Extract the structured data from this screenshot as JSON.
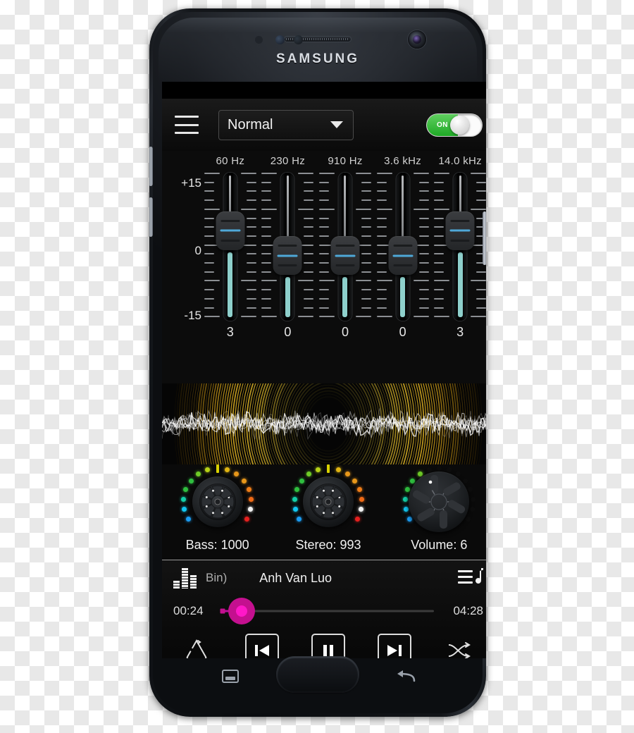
{
  "device": {
    "brand": "SAMSUNG",
    "nav": {
      "recents": "recents-button",
      "home": "home-button",
      "back": "back-button"
    },
    "hardware": {
      "power": "power-button",
      "volume_up": "volume-up-button",
      "volume_down": "volume-down-button"
    }
  },
  "header": {
    "menu_icon": "hamburger-menu-icon",
    "preset": {
      "selected": "Normal",
      "caret_icon": "chevron-down-icon"
    },
    "power_toggle": {
      "state_label": "ON",
      "enabled": true,
      "on_color": "#21ab27"
    }
  },
  "equalizer": {
    "scale": {
      "top": "+15",
      "mid": "0",
      "bottom": "-15"
    },
    "bands": [
      {
        "frequency": "60 Hz",
        "value": "3",
        "gain": 3,
        "thumb_top_pct": 26
      },
      {
        "frequency": "230 Hz",
        "value": "0",
        "gain": 0,
        "thumb_top_pct": 43
      },
      {
        "frequency": "910 Hz",
        "value": "0",
        "gain": 0,
        "thumb_top_pct": 43
      },
      {
        "frequency": "3.6 kHz",
        "value": "0",
        "gain": 0,
        "thumb_top_pct": 43
      },
      {
        "frequency": "14.0 kHz",
        "value": "3",
        "gain": 3,
        "thumb_top_pct": 26
      }
    ],
    "fill_color": "#8ed0cc",
    "thumb_line_color": "#4fa8d8"
  },
  "visualizer": {
    "name": "audio-waveform-visualizer",
    "wave_color": "#ffffff",
    "arc_color": "#c8950d"
  },
  "knobs": [
    {
      "name": "bass-knob",
      "label": "Bass: 1000",
      "param": "Bass",
      "value": "1000",
      "style": "ridged",
      "leds_lit": 13
    },
    {
      "name": "stereo-knob",
      "label": "Stereo: 993",
      "param": "Stereo",
      "value": "993",
      "style": "ridged",
      "leds_lit": 13
    },
    {
      "name": "volume-knob",
      "label": "Volume: 6",
      "param": "Volume",
      "value": "6",
      "style": "spoked",
      "leds_lit": 6
    }
  ],
  "led_colors": [
    "#1b9bf0",
    "#12c6f0",
    "#13cfa8",
    "#2fbf3f",
    "#6ecb27",
    "#b7d117",
    "#d9d200",
    "#dfb413",
    "#e8971a",
    "#ee7d18",
    "#ef6a16",
    "#e5201f"
  ],
  "player": {
    "eq_icon": "equalizer-bars-icon",
    "playlist_icon": "playlist-music-note-icon",
    "artist": "Bin)",
    "title": "Anh Van Luo",
    "time_elapsed": "00:24",
    "time_total": "04:28",
    "progress_pct": 9,
    "accent_color": "#c4108f",
    "controls": {
      "repeat": "repeat-button",
      "previous": "previous-track-button",
      "playpause": "pause-button",
      "next": "next-track-button",
      "shuffle": "shuffle-button"
    }
  }
}
